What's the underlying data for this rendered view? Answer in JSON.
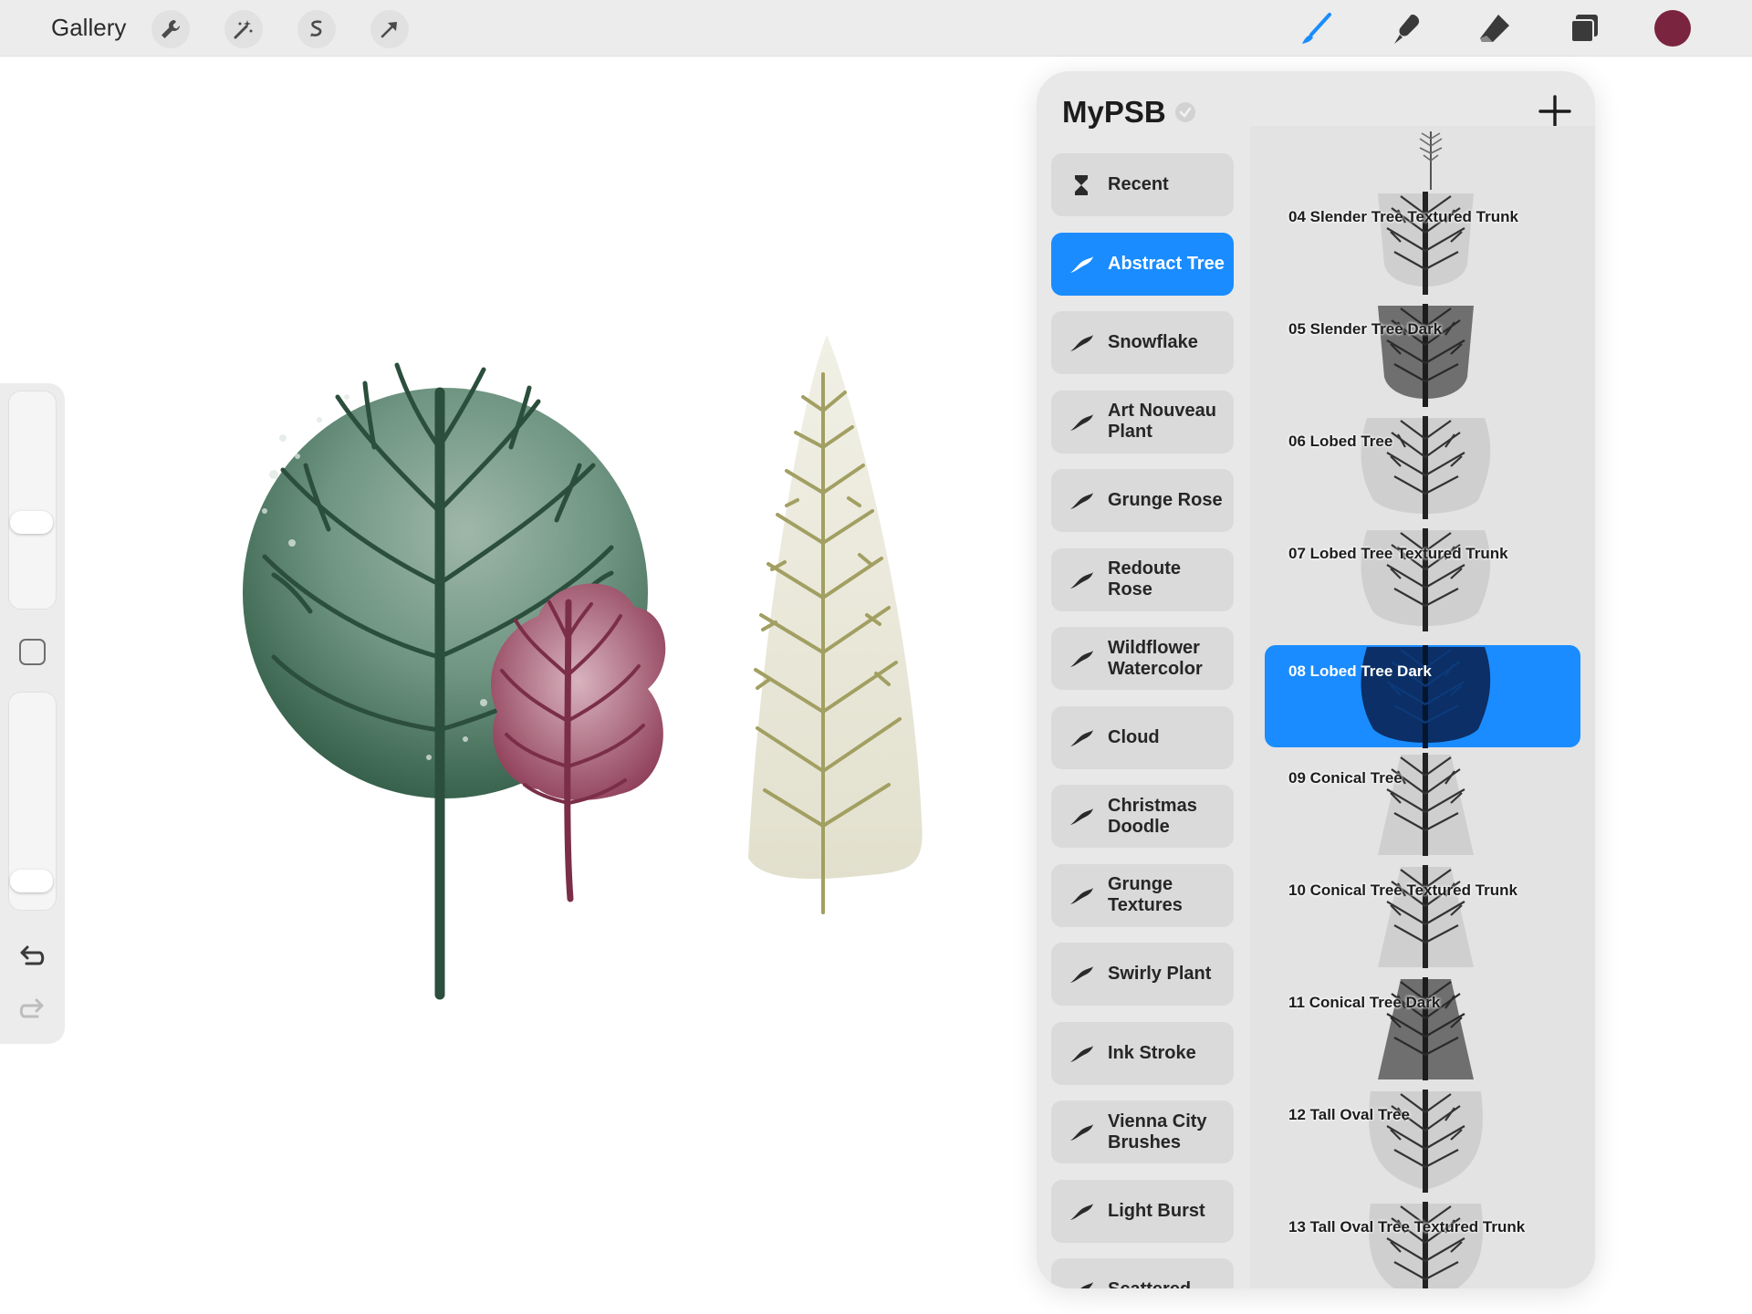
{
  "topbar": {
    "gallery_label": "Gallery",
    "left_tools": [
      "wrench-icon",
      "magic-wand-icon",
      "selection-icon",
      "transform-arrow-icon"
    ],
    "right_tools": [
      "brush-icon",
      "smudge-icon",
      "eraser-icon",
      "layers-icon"
    ],
    "current_color": "#7a2440",
    "brush_accent": "#1a8cff"
  },
  "sidebar": {
    "brush_size_level": 0.38,
    "opacity_level": 0.07
  },
  "library": {
    "title": "MyPSB",
    "add_label": "+",
    "sets": [
      {
        "label": "Recent",
        "icon": "hourglass-icon",
        "active": false
      },
      {
        "label": "Abstract Tree",
        "icon": "brush-stroke-icon",
        "active": true
      },
      {
        "label": "Snowflake",
        "icon": "brush-stroke-icon",
        "active": false
      },
      {
        "label": "Art Nouveau Plant",
        "icon": "brush-stroke-icon",
        "active": false
      },
      {
        "label": "Grunge Rose",
        "icon": "brush-stroke-icon",
        "active": false
      },
      {
        "label": "Redoute Rose",
        "icon": "brush-stroke-icon",
        "active": false
      },
      {
        "label": "Wildflower Watercolor",
        "icon": "brush-stroke-icon",
        "active": false
      },
      {
        "label": "Cloud",
        "icon": "brush-stroke-icon",
        "active": false
      },
      {
        "label": "Christmas Doodle",
        "icon": "brush-stroke-icon",
        "active": false
      },
      {
        "label": "Grunge Textures",
        "icon": "brush-stroke-icon",
        "active": false
      },
      {
        "label": "Swirly Plant",
        "icon": "brush-stroke-icon",
        "active": false
      },
      {
        "label": "Ink Stroke",
        "icon": "brush-stroke-icon",
        "active": false
      },
      {
        "label": "Vienna City Brushes",
        "icon": "brush-stroke-icon",
        "active": false
      },
      {
        "label": "Light Burst",
        "icon": "brush-stroke-icon",
        "active": false
      },
      {
        "label": "Scattered",
        "icon": "brush-stroke-icon",
        "active": false
      }
    ],
    "brushes": [
      {
        "label": "04 Slender Tree Textured Trunk",
        "tone": "light",
        "shape": "slender",
        "active": false
      },
      {
        "label": "05 Slender Tree Dark",
        "tone": "dark",
        "shape": "slender",
        "active": false
      },
      {
        "label": "06 Lobed Tree",
        "tone": "light",
        "shape": "lobed",
        "active": false
      },
      {
        "label": "07 Lobed Tree Textured Trunk",
        "tone": "light",
        "shape": "lobed",
        "active": false
      },
      {
        "label": "08 Lobed Tree Dark",
        "tone": "dark",
        "shape": "lobed",
        "active": true
      },
      {
        "label": "09 Conical Tree",
        "tone": "light",
        "shape": "conical",
        "active": false
      },
      {
        "label": "10 Conical Tree Textured Trunk",
        "tone": "light",
        "shape": "conical",
        "active": false
      },
      {
        "label": "11 Conical Tree Dark",
        "tone": "dark",
        "shape": "conical",
        "active": false
      },
      {
        "label": "12 Tall Oval Tree",
        "tone": "light",
        "shape": "oval",
        "active": false
      },
      {
        "label": "13 Tall Oval Tree Textured Trunk",
        "tone": "light",
        "shape": "oval",
        "active": false
      }
    ]
  },
  "canvas": {
    "tree_colors": {
      "round_tree": "#2f5a44",
      "conifer_fill": "#e9e8da",
      "conifer_branches": "#a29f62",
      "small_tree": "#8a3752"
    }
  }
}
